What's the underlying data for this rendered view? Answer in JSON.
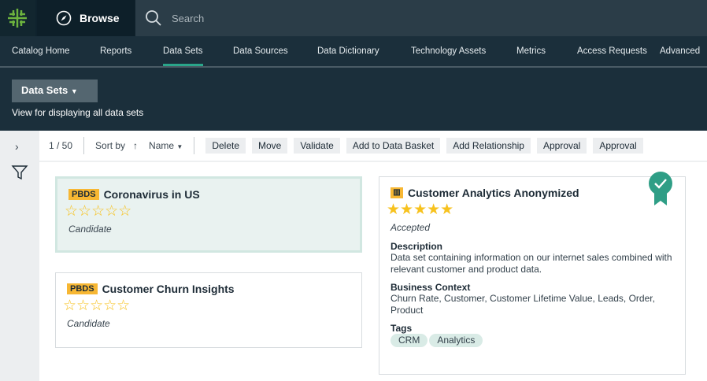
{
  "topbar": {
    "browse": "Browse",
    "search_placeholder": "Search"
  },
  "nav": [
    "Catalog Home",
    "Reports",
    "Data Sets",
    "Data Sources",
    "Data Dictionary",
    "Technology Assets",
    "Metrics",
    "Access Requests",
    "Advanced"
  ],
  "nav_active": "Data Sets",
  "view": {
    "label": "Data Sets",
    "description": "View for displaying all data sets"
  },
  "toolbar": {
    "count": "1 / 50",
    "sort_by": "Sort by",
    "sort_field": "Name",
    "buttons": [
      "Delete",
      "Move",
      "Validate",
      "Add to Data Basket",
      "Add Relationship",
      "Approval",
      "Approval"
    ]
  },
  "cards": [
    {
      "badge": "PBDS",
      "title": "Coronavirus in US",
      "rating": 0,
      "status": "Candidate"
    },
    {
      "badge": "PBDS",
      "title": "Customer Churn Insights",
      "rating": 0,
      "status": "Candidate"
    },
    {
      "title": "Customer Analytics Anonymized",
      "rating": 5,
      "status": "Accepted",
      "certified": true,
      "description_label": "Description",
      "description": "Data set containing information on our internet sales combined with relevant customer and product data.",
      "context_label": "Business Context",
      "context": "Churn Rate, Customer, Customer Lifetime Value, Leads, Order, Product",
      "tags_label": "Tags",
      "tags": [
        "CRM",
        "Analytics"
      ]
    }
  ],
  "colors": {
    "accent": "#2aa58a",
    "badge": "#f7b733",
    "star": "#f7c21e"
  }
}
